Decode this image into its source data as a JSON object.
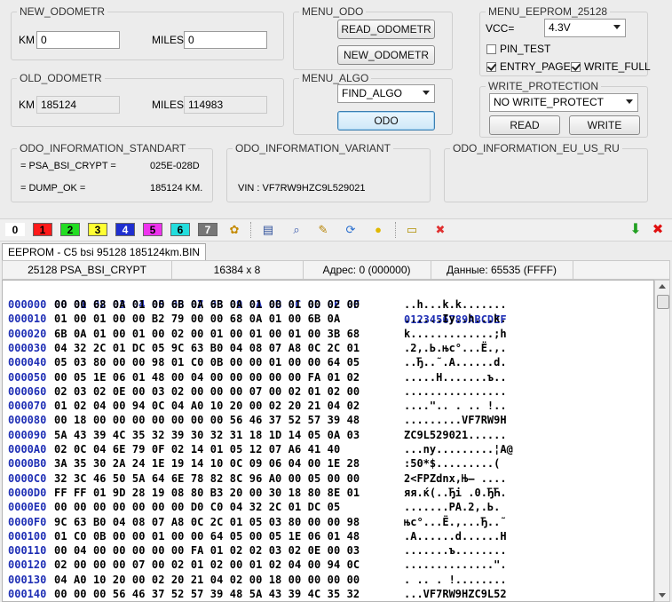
{
  "new_odometr": {
    "title": "NEW_ODOMETR",
    "km_label": "KM",
    "km_value": "0",
    "miles_label": "MILES",
    "miles_value": "0"
  },
  "old_odometr": {
    "title": "OLD_ODOMETR",
    "km_label": "KM",
    "km_value": "185124",
    "miles_label": "MILES",
    "miles_value": "114983"
  },
  "menu_odo": {
    "title": "MENU_ODO",
    "read_label": "READ_ODOMETR",
    "new_label": "NEW_ODOMETR"
  },
  "menu_algo": {
    "title": "MENU_ALGO",
    "algo_selected": "FIND_ALGO",
    "odo_label": "ODO"
  },
  "menu_eeprom": {
    "title": "MENU_EEPROM_25128",
    "vcc_label": "VCC=",
    "vcc_value": "4.3V",
    "pin_test": "PIN_TEST",
    "entry_page": "ENTRY_PAGE",
    "write_full": "WRITE_FULL"
  },
  "write_protection": {
    "title": "WRITE_PROTECTION",
    "selected": "NO WRITE_PROTECT",
    "read_label": "READ",
    "write_label": "WRITE"
  },
  "info_standart": {
    "title": "ODO_INFORMATION_STANDART",
    "line1_label": "= PSA_BSI_CRYPT =",
    "line1_value": "025E-028D",
    "line2_label": "= DUMP_OK =",
    "line2_value": "185124 KM."
  },
  "info_variant": {
    "title": "ODO_INFORMATION_VARIANT",
    "vin": "VIN : VF7RW9HZC9L529021"
  },
  "info_eu": {
    "title": "ODO_INFORMATION_EU_US_RU"
  },
  "toolbar": {
    "colors": [
      {
        "label": "0",
        "bg": "#ffffff",
        "fg": "#000000"
      },
      {
        "label": "1",
        "bg": "#ff1a1a",
        "fg": "#000000"
      },
      {
        "label": "2",
        "bg": "#22dd22",
        "fg": "#000000"
      },
      {
        "label": "3",
        "bg": "#ffff33",
        "fg": "#000000"
      },
      {
        "label": "4",
        "bg": "#1f2fd0",
        "fg": "#ffffff"
      },
      {
        "label": "5",
        "bg": "#ee33ee",
        "fg": "#000000"
      },
      {
        "label": "6",
        "bg": "#22dddd",
        "fg": "#000000"
      },
      {
        "label": "7",
        "bg": "#777777",
        "fg": "#ffffff"
      }
    ]
  },
  "tab": {
    "label": "EEPROM - C5 bsi 95128 185124km.BIN"
  },
  "status": {
    "chip": "25128 PSA_BSI_CRYPT",
    "size": "16384 x 8",
    "address": "Адрес: 0 (000000)",
    "data": "Данные: 65535 (FFFF)"
  },
  "hex": {
    "header_bytes": "00 01 02 03 04 05 06 07 08 09 0A 0B 0C 0D 0E 0F",
    "header_ascii": "0123456789ABCDEF",
    "rows": [
      {
        "addr": "000000",
        "bytes": "00 00 68 0A 01 00 6B 0A 6B 0A 01 00 01 00 02 00",
        "ascii": "..h...k.k......."
      },
      {
        "addr": "000010",
        "bytes": "01 00 01 00 00 B2 79 00 00 68 0A 01 00 6B 0A",
        "ascii": "......Iy..h...k."
      },
      {
        "addr": "000020",
        "bytes": "6B 0A 01 00 01 00 02 00 01 00 01 00 01 00 3B 68",
        "ascii": "k.............;h"
      },
      {
        "addr": "000030",
        "bytes": "04 32 2C 01 DC 05 9C 63 B0 04 08 07 A8 0C 2C 01",
        "ascii": ".2,.Ь.њс°...Ё.,."
      },
      {
        "addr": "000040",
        "bytes": "05 03 80 00 00 98 01 C0 0B 00 00 01 00 00 64 05",
        "ascii": "..Ђ..˜.A......d."
      },
      {
        "addr": "000050",
        "bytes": "00 05 1E 06 01 48 00 04 00 00 00 00 00 FA 01 02",
        "ascii": ".....H.......ъ.."
      },
      {
        "addr": "000060",
        "bytes": "02 03 02 0E 00 03 02 00 00 00 07 00 02 01 02 00",
        "ascii": "................"
      },
      {
        "addr": "000070",
        "bytes": "01 02 04 00 94 0C 04 A0 10 20 00 02 20 21 04 02",
        "ascii": "....\".. . .. !.."
      },
      {
        "addr": "000080",
        "bytes": "00 18 00 00 00 00 00 00 00 56 46 37 52 57 39 48",
        "ascii": ".........VF7RW9H"
      },
      {
        "addr": "000090",
        "bytes": "5A 43 39 4C 35 32 39 30 32 31 18 1D 14 05 0A 03",
        "ascii": "ZC9L529021......"
      },
      {
        "addr": "0000A0",
        "bytes": "02 0C 04 6E 79 0F 02 14 01 05 12 07 A6 41 40",
        "ascii": "...ny.........¦A@"
      },
      {
        "addr": "0000B0",
        "bytes": "3A 35 30 2A 24 1E 19 14 10 0C 09 06 04 00 1E 28",
        "ascii": ":50*$.........("
      },
      {
        "addr": "0000C0",
        "bytes": "32 3C 46 50 5A 64 6E 78 82 8C 96 A0 00 05 00 00",
        "ascii": "2<FPZdnx‚Њ– ...."
      },
      {
        "addr": "0000D0",
        "bytes": "FF FF 01 9D 28 19 08 80 B3 20 00 30 18 80 8E 01",
        "ascii": "яя.ќ(..Ђі .0.ЂЋ."
      },
      {
        "addr": "0000E0",
        "bytes": "00 00 00 00 00 00 00 D0 C0 04 32 2C 01 DC 05",
        "ascii": ".......PA.2,.Ь."
      },
      {
        "addr": "0000F0",
        "bytes": "9C 63 B0 04 08 07 A8 0C 2C 01 05 03 80 00 00 98",
        "ascii": "њс°...Ё.,...Ђ..˜"
      },
      {
        "addr": "000100",
        "bytes": "01 C0 0B 00 00 01 00 00 64 05 00 05 1E 06 01 48",
        "ascii": ".A......d......H"
      },
      {
        "addr": "000110",
        "bytes": "00 04 00 00 00 00 00 FA 01 02 02 03 02 0E 00 03",
        "ascii": ".......ъ........"
      },
      {
        "addr": "000120",
        "bytes": "02 00 00 00 07 00 02 01 02 00 01 02 04 00 94 0C",
        "ascii": "..............\"."
      },
      {
        "addr": "000130",
        "bytes": "04 A0 10 20 00 02 20 21 04 02 00 18 00 00 00 00",
        "ascii": ". .. . !........"
      },
      {
        "addr": "000140",
        "bytes": "00 00 00 56 46 37 52 57 39 48 5A 43 39 4C 35 32",
        "ascii": "...VF7RW9HZC9L52"
      }
    ]
  }
}
